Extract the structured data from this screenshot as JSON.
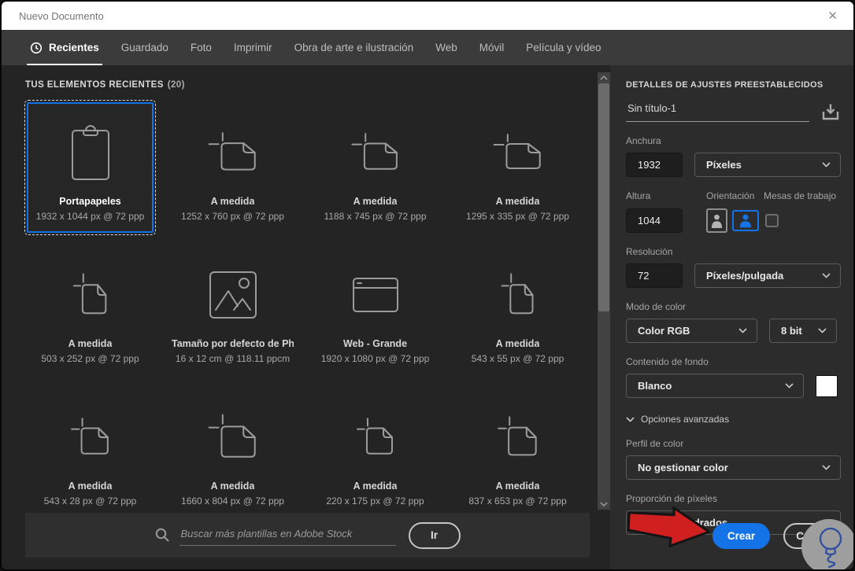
{
  "window": {
    "title": "Nuevo Documento",
    "close_glyph": "✕"
  },
  "tabs": [
    {
      "label": "Recientes",
      "active": true
    },
    {
      "label": "Guardado"
    },
    {
      "label": "Foto"
    },
    {
      "label": "Imprimir"
    },
    {
      "label": "Obra de arte e ilustración"
    },
    {
      "label": "Web"
    },
    {
      "label": "Móvil"
    },
    {
      "label": "Película y vídeo"
    }
  ],
  "recents": {
    "heading": "TUS ELEMENTOS RECIENTES",
    "count": "(20)",
    "items": [
      {
        "title": "Portapapeles",
        "size": "1932 x 1044 px @ 72 ppp",
        "icon": "clipboard",
        "selected": true
      },
      {
        "title": "A medida",
        "size": "1252 x 760 px @ 72 ppp",
        "icon": "custom-doc"
      },
      {
        "title": "A medida",
        "size": "1188 x 745 px @ 72 ppp",
        "icon": "custom-doc"
      },
      {
        "title": "A medida",
        "size": "1295 x 335 px @ 72 ppp",
        "icon": "custom-doc"
      },
      {
        "title": "A medida",
        "size": "503 x 252 px @ 72 ppp",
        "icon": "custom-doc"
      },
      {
        "title": "Tamaño por defecto de Ph...",
        "size": "16 x 12 cm @ 118.11 ppcm",
        "icon": "photo"
      },
      {
        "title": "Web - Grande",
        "size": "1920 x 1080 px @ 72 ppp",
        "icon": "web-browser"
      },
      {
        "title": "A medida",
        "size": "543 x 55 px @ 72 ppp",
        "icon": "custom-doc"
      },
      {
        "title": "A medida",
        "size": "543 x 28 px @ 72 ppp",
        "icon": "custom-doc"
      },
      {
        "title": "A medida",
        "size": "1660 x 804 px @ 72 ppp",
        "icon": "custom-doc"
      },
      {
        "title": "A medida",
        "size": "220 x 175 px @ 72 ppp",
        "icon": "custom-doc"
      },
      {
        "title": "A medida",
        "size": "837 x 653 px @ 72 ppp",
        "icon": "custom-doc"
      }
    ]
  },
  "search": {
    "placeholder": "Buscar más plantillas en Adobe Stock",
    "go_label": "Ir"
  },
  "panel": {
    "heading": "DETALLES DE AJUSTES PREESTABLECIDOS",
    "doc_name": "Sin título-1",
    "width_label": "Anchura",
    "width_value": "1932",
    "width_unit": "Píxeles",
    "height_label": "Altura",
    "height_value": "1044",
    "orientation_label": "Orientación",
    "artboards_label": "Mesas de trabajo",
    "resolution_label": "Resolución",
    "resolution_value": "72",
    "resolution_unit": "Píxeles/pulgada",
    "color_mode_label": "Modo de color",
    "color_mode_value": "Color RGB",
    "bit_depth_value": "8 bit",
    "background_label": "Contenido de fondo",
    "background_value": "Blanco",
    "background_swatch": "#ffffff",
    "advanced_label": "Opciones avanzadas",
    "profile_label": "Perfil de color",
    "profile_value": "No gestionar color",
    "pixel_ratio_label": "Proporción de píxeles",
    "pixel_ratio_value": "Píxeles cuadrados",
    "create_label": "Crear",
    "close_label": "Cerrar"
  },
  "colors": {
    "accent_blue": "#1473e6",
    "arrow_red": "#d01f1f",
    "tabbar_bg": "#3b3b3b",
    "panel_bg": "#2c2c2c"
  }
}
